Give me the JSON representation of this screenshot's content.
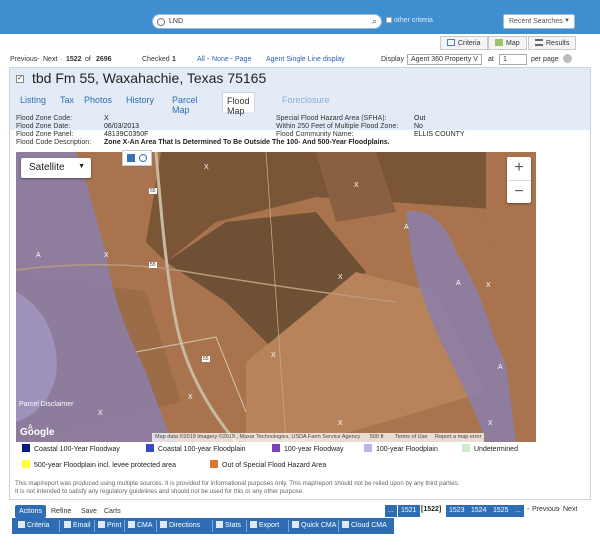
{
  "search": {
    "value": "LND",
    "other_criteria": "other criteria",
    "recent_searches": "Recent Searches"
  },
  "views": {
    "criteria": "Criteria",
    "map": "Map",
    "results": "Results"
  },
  "nav": {
    "previous": "Previous",
    "next": "Next",
    "position": "1522",
    "total": "2696",
    "of": "of",
    "checked_label": "Checked",
    "checked_count": "1",
    "all": "All",
    "none": "None",
    "page": "Page",
    "single_line": "Agent Single Line display",
    "display_label": "Display",
    "display_value": "Agent 360 Property V",
    "at_label": "at",
    "at_value": "1",
    "per_page": "per page"
  },
  "listing": {
    "title": "tbd Fm 55, Waxahachie, Texas 75165",
    "tabs": [
      "Listing",
      "Tax",
      "Photos",
      "History",
      "Parcel Map",
      "Flood Map",
      "Foreclosure"
    ],
    "active_tab": "Flood Map"
  },
  "flood": {
    "rows": [
      {
        "k": "Flood Zone Code:",
        "v": "X",
        "k2": "Special Flood Hazard Area (SFHA):",
        "v2": "Out"
      },
      {
        "k": "Flood Zone Date:",
        "v": "06/03/2013",
        "k2": "Within 250 Feet of Multiple Flood Zone:",
        "v2": "No"
      },
      {
        "k": "Flood Zone Panel:",
        "v": "48139C0350F",
        "k2": "Flood Community Name:",
        "v2": "ELLIS COUNTY"
      },
      {
        "k": "Flood Code Description:",
        "v": "Zone X-An Area That Is Determined To Be Outside The 100- And 500-Year Floodplains.",
        "k2": "",
        "v2": ""
      }
    ]
  },
  "map": {
    "type": "Satellite",
    "zoom_in": "+",
    "zoom_out": "−",
    "google": "Google",
    "disclaimer": "Parcel Disclaimer",
    "attribution": "Map data ©2019 Imagery ©2019 , Maxar Technologies, USDA Farm Service Agency",
    "scale": "500 ft",
    "terms": "Terms of Use",
    "report": "Report a map error",
    "road_labels": [
      "55",
      "55",
      "55"
    ],
    "x_markers": "X",
    "a_markers": "A"
  },
  "legend": [
    {
      "label": "Coastal 100-Year Floodway",
      "color": "#0b1a80"
    },
    {
      "label": "Coastal 100-year Floodplain",
      "color": "#3a48c8"
    },
    {
      "label": "100-year Floodway",
      "color": "#7d3fc4"
    },
    {
      "label": "100-year Floodplain",
      "color": "#c2b3e6"
    },
    {
      "label": "Undetermined",
      "color": "#cdeecb"
    },
    {
      "label": "500-year Floodplain incl. levee protected area",
      "color": "#ffff33"
    },
    {
      "label": "Out of Special Flood Hazard Area",
      "color": "#d97a2b"
    }
  ],
  "note": [
    "This map/report was produced using multiple sources. It is provided for informational purposes only. This map/report should not be relied upon by any third parties.",
    "It is not intended to satisfy any regulatory guidelines and should not be used for this or any other purpose."
  ],
  "actions": {
    "actions": "Actions",
    "refine": "Refine",
    "save": "Save",
    "carts": "Carts"
  },
  "pager": {
    "ellipsis": "...",
    "pages": [
      "1521",
      "[1522]",
      "1523",
      "1524",
      "1525"
    ],
    "prev": "Previous",
    "next": "Next"
  },
  "toolbar": [
    "Criteria",
    "Email",
    "Print",
    "CMA",
    "Directions",
    "Stats",
    "Export",
    "Quick CMA",
    "Cloud CMA"
  ]
}
